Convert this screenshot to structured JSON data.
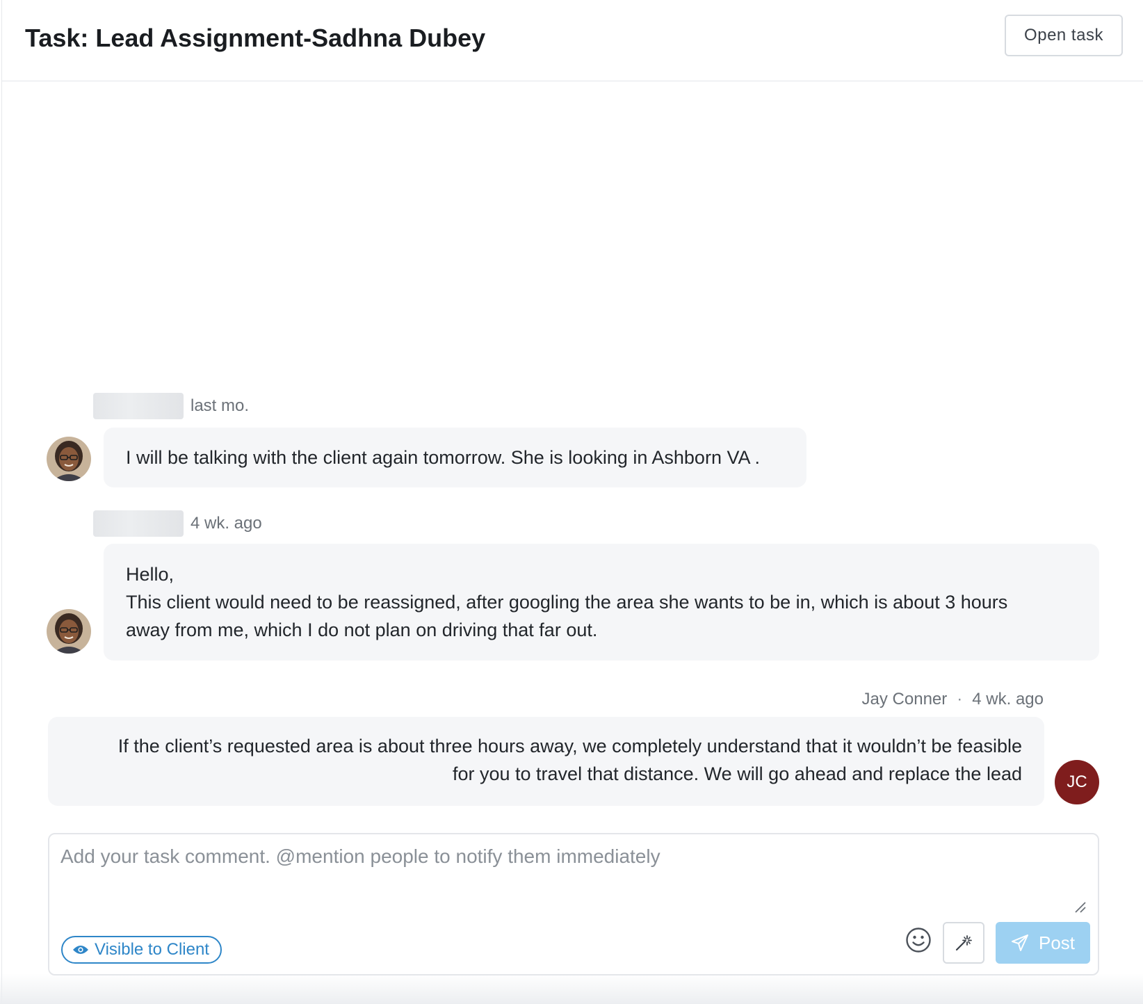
{
  "header": {
    "title": "Task: Lead Assignment-Sadhna Dubey",
    "open_task_label": "Open task"
  },
  "comments": [
    {
      "author": "",
      "author_redacted": true,
      "time": "last mo.",
      "avatar": "profile-photo",
      "lines": [
        "I will be talking with the client again tomorrow. She is looking in Ashborn VA ."
      ]
    },
    {
      "author": "",
      "author_redacted": true,
      "time": "4 wk. ago",
      "avatar": "profile-photo",
      "lines": [
        "Hello,",
        "This client would need to be reassigned, after googling the area she wants to be in, which is about 3 hours",
        "away from me, which I do not plan on driving that far out."
      ]
    },
    {
      "author": "Jay Conner",
      "separator": "·",
      "time": "4 wk. ago",
      "avatar_initials": "JC",
      "avatar_color": "#7f1d1d",
      "lines": [
        "If the client’s requested area is about three hours away, we completely understand that it wouldn’t be feasible",
        "for you to travel that distance. We will go ahead and replace the lead"
      ]
    }
  ],
  "composer": {
    "placeholder": "Add your task comment. @mention people to notify them immediately",
    "value": "",
    "visibility_label": "Visible to Client",
    "visibility_icon": "eye-icon",
    "emoji_icon": "smiley-icon",
    "magic_icon": "magic-wand-icon",
    "post_label": "Post",
    "post_icon": "send-icon"
  },
  "colors": {
    "accent": "#2e86c8",
    "post_button": "#9dd1f2",
    "bubble_bg": "#f5f6f8",
    "avatar_jc": "#7f1d1d"
  }
}
